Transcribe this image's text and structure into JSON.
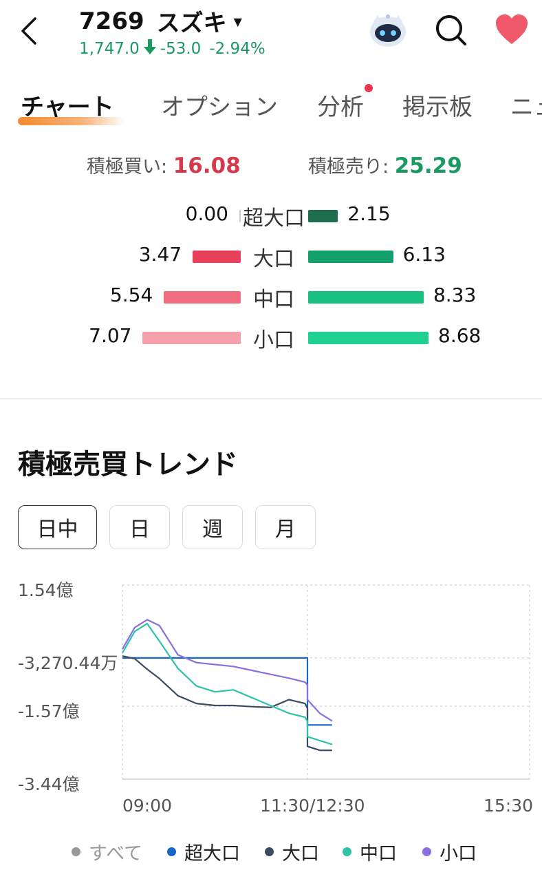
{
  "header": {
    "code": "7269",
    "name": "スズキ",
    "price": "1,747.0",
    "change": "-53.0",
    "change_pct": "-2.94%",
    "price_color": "#1a9a62"
  },
  "tabs": [
    {
      "label": "チャート",
      "active": true
    },
    {
      "label": "オプション",
      "active": false
    },
    {
      "label": "分析",
      "active": false,
      "has_dot": true
    },
    {
      "label": "掲示板",
      "active": false
    },
    {
      "label": "ニュ",
      "active": false
    }
  ],
  "summary": {
    "buy_label": "積極買い:",
    "buy_value": "16.08",
    "sell_label": "積極売り:",
    "sell_value": "25.29"
  },
  "flow_rows": [
    {
      "label": "超大口",
      "buy": "0.00",
      "sell": "2.15",
      "buy_color": "#c8ccd0",
      "sell_color": "#1e6e4e"
    },
    {
      "label": "大口",
      "buy": "3.47",
      "sell": "6.13",
      "buy_color": "#e8405a",
      "sell_color": "#14a06a"
    },
    {
      "label": "中口",
      "buy": "5.54",
      "sell": "8.33",
      "buy_color": "#f06d80",
      "sell_color": "#18c080"
    },
    {
      "label": "小口",
      "buy": "7.07",
      "sell": "8.68",
      "buy_color": "#f6a0ab",
      "sell_color": "#1fd090"
    }
  ],
  "trend": {
    "title": "積極売買トレンド",
    "periods": [
      {
        "label": "日中",
        "active": true
      },
      {
        "label": "日",
        "active": false
      },
      {
        "label": "週",
        "active": false
      },
      {
        "label": "月",
        "active": false
      }
    ]
  },
  "chart_data": {
    "type": "line",
    "y_tick_labels": [
      "1.54億",
      "-3,270.44万",
      "-1.57億",
      "-3.44億"
    ],
    "x_tick_labels": [
      "09:00",
      "11:30/12:30",
      "15:30"
    ],
    "ylim": [
      -3.44,
      1.54
    ],
    "y_unit": "億",
    "grid": true,
    "legend_position": "bottom",
    "x": [
      "09:00",
      "09:10",
      "09:20",
      "09:30",
      "09:45",
      "10:00",
      "10:15",
      "10:30",
      "10:45",
      "11:00",
      "11:15",
      "11:28",
      "11:30",
      "12:30",
      "12:40",
      "12:50"
    ],
    "series": [
      {
        "name": "超大口",
        "color": "#1a66c8",
        "values": [
          -0.33,
          -0.33,
          -0.33,
          -0.33,
          -0.33,
          -0.33,
          -0.33,
          -0.33,
          -0.33,
          -0.33,
          -0.33,
          -0.33,
          -0.33,
          -2.05,
          -2.05,
          -2.05
        ]
      },
      {
        "name": "大口",
        "color": "#3c4a62",
        "values": [
          -0.28,
          -0.35,
          -0.62,
          -0.86,
          -1.3,
          -1.5,
          -1.55,
          -1.55,
          -1.58,
          -1.6,
          -1.4,
          -1.5,
          -1.62,
          -2.6,
          -2.7,
          -2.7
        ]
      },
      {
        "name": "中口",
        "color": "#2ec2a8",
        "values": [
          -0.2,
          0.35,
          0.55,
          0.1,
          -0.6,
          -1.05,
          -1.2,
          -1.15,
          -1.35,
          -1.55,
          -1.75,
          -1.85,
          -1.95,
          -2.35,
          -2.45,
          -2.55
        ]
      },
      {
        "name": "小口",
        "color": "#8b6fe0",
        "values": [
          -0.1,
          0.45,
          0.65,
          0.5,
          -0.25,
          -0.45,
          -0.5,
          -0.55,
          -0.65,
          -0.75,
          -0.85,
          -0.95,
          -1.02,
          -1.4,
          -1.75,
          -1.95
        ]
      }
    ]
  },
  "legend": [
    {
      "label": "すべて",
      "color": "#999999",
      "dim": true
    },
    {
      "label": "超大口",
      "color": "#1a66c8",
      "dim": false
    },
    {
      "label": "大口",
      "color": "#3c4a62",
      "dim": false
    },
    {
      "label": "中口",
      "color": "#2ec2a8",
      "dim": false
    },
    {
      "label": "小口",
      "color": "#8b6fe0",
      "dim": false
    }
  ]
}
